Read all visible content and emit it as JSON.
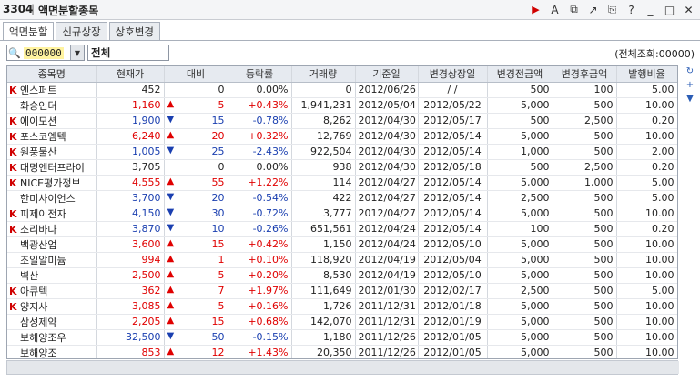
{
  "window": {
    "code": "3304",
    "separator": "|",
    "title": "액면분할종목"
  },
  "tabs": [
    {
      "label": "액면분할"
    },
    {
      "label": "신규상장"
    },
    {
      "label": "상호변경"
    }
  ],
  "filter": {
    "code": "000000",
    "name": "전체",
    "count_text": "(전체조회:00000)"
  },
  "table": {
    "headers": [
      "종목명",
      "현재가",
      "대비",
      "등락률",
      "거래량",
      "기준일",
      "변경상장일",
      "변경전금액",
      "변경후금액",
      "발행비율"
    ],
    "rows": [
      {
        "k": true,
        "name": "엔스퍼트",
        "price": "452",
        "dir": "",
        "diff": "0",
        "rate": "0.00%",
        "vol": "0",
        "base": "2012/06/26",
        "listdate": "/ /",
        "before": "500",
        "after": "100",
        "ratio": "5.00"
      },
      {
        "k": false,
        "name": "화승인더",
        "price": "1,160",
        "dir": "up",
        "diff": "5",
        "rate": "+0.43%",
        "vol": "1,941,231",
        "base": "2012/05/04",
        "listdate": "2012/05/22",
        "before": "5,000",
        "after": "500",
        "ratio": "10.00"
      },
      {
        "k": true,
        "name": "에이모션",
        "price": "1,900",
        "dir": "dn",
        "diff": "15",
        "rate": "-0.78%",
        "vol": "8,262",
        "base": "2012/04/30",
        "listdate": "2012/05/17",
        "before": "500",
        "after": "2,500",
        "ratio": "0.20"
      },
      {
        "k": true,
        "name": "포스코엠텍",
        "price": "6,240",
        "dir": "up",
        "diff": "20",
        "rate": "+0.32%",
        "vol": "12,769",
        "base": "2012/04/30",
        "listdate": "2012/05/14",
        "before": "5,000",
        "after": "500",
        "ratio": "10.00"
      },
      {
        "k": true,
        "name": "원풍물산",
        "price": "1,005",
        "dir": "dn",
        "diff": "25",
        "rate": "-2.43%",
        "vol": "922,504",
        "base": "2012/04/30",
        "listdate": "2012/05/14",
        "before": "1,000",
        "after": "500",
        "ratio": "2.00"
      },
      {
        "k": true,
        "name": "대명엔터프라이",
        "price": "3,705",
        "dir": "",
        "diff": "0",
        "rate": "0.00%",
        "vol": "938",
        "base": "2012/04/30",
        "listdate": "2012/05/18",
        "before": "500",
        "after": "2,500",
        "ratio": "0.20"
      },
      {
        "k": true,
        "name": "NICE평가정보",
        "price": "4,555",
        "dir": "up",
        "diff": "55",
        "rate": "+1.22%",
        "vol": "114",
        "base": "2012/04/27",
        "listdate": "2012/05/14",
        "before": "5,000",
        "after": "1,000",
        "ratio": "5.00"
      },
      {
        "k": false,
        "name": "한미사이언스",
        "price": "3,700",
        "dir": "dn",
        "diff": "20",
        "rate": "-0.54%",
        "vol": "422",
        "base": "2012/04/27",
        "listdate": "2012/05/14",
        "before": "2,500",
        "after": "500",
        "ratio": "5.00"
      },
      {
        "k": true,
        "name": "피제이전자",
        "price": "4,150",
        "dir": "dn",
        "diff": "30",
        "rate": "-0.72%",
        "vol": "3,777",
        "base": "2012/04/27",
        "listdate": "2012/05/14",
        "before": "5,000",
        "after": "500",
        "ratio": "10.00"
      },
      {
        "k": true,
        "name": "소리바다",
        "price": "3,870",
        "dir": "dn",
        "diff": "10",
        "rate": "-0.26%",
        "vol": "651,561",
        "base": "2012/04/24",
        "listdate": "2012/05/14",
        "before": "100",
        "after": "500",
        "ratio": "0.20"
      },
      {
        "k": false,
        "name": "백광산업",
        "price": "3,600",
        "dir": "up",
        "diff": "15",
        "rate": "+0.42%",
        "vol": "1,150",
        "base": "2012/04/24",
        "listdate": "2012/05/10",
        "before": "5,000",
        "after": "500",
        "ratio": "10.00"
      },
      {
        "k": false,
        "name": "조일알미늄",
        "price": "994",
        "dir": "up",
        "diff": "1",
        "rate": "+0.10%",
        "vol": "118,920",
        "base": "2012/04/19",
        "listdate": "2012/05/04",
        "before": "5,000",
        "after": "500",
        "ratio": "10.00"
      },
      {
        "k": false,
        "name": "벽산",
        "price": "2,500",
        "dir": "up",
        "diff": "5",
        "rate": "+0.20%",
        "vol": "8,530",
        "base": "2012/04/19",
        "listdate": "2012/05/10",
        "before": "5,000",
        "after": "500",
        "ratio": "10.00"
      },
      {
        "k": true,
        "name": "아큐텍",
        "price": "362",
        "dir": "up",
        "diff": "7",
        "rate": "+1.97%",
        "vol": "111,649",
        "base": "2012/01/30",
        "listdate": "2012/02/17",
        "before": "2,500",
        "after": "500",
        "ratio": "5.00"
      },
      {
        "k": true,
        "name": "양지사",
        "price": "3,085",
        "dir": "up",
        "diff": "5",
        "rate": "+0.16%",
        "vol": "1,726",
        "base": "2011/12/31",
        "listdate": "2012/01/18",
        "before": "5,000",
        "after": "500",
        "ratio": "10.00"
      },
      {
        "k": false,
        "name": "삼성제약",
        "price": "2,205",
        "dir": "up",
        "diff": "15",
        "rate": "+0.68%",
        "vol": "142,070",
        "base": "2011/12/31",
        "listdate": "2012/01/19",
        "before": "5,000",
        "after": "500",
        "ratio": "10.00"
      },
      {
        "k": false,
        "name": "보해양조우",
        "price": "32,500",
        "dir": "dn",
        "diff": "50",
        "rate": "-0.15%",
        "vol": "1,180",
        "base": "2011/12/26",
        "listdate": "2012/01/05",
        "before": "5,000",
        "after": "500",
        "ratio": "10.00"
      },
      {
        "k": false,
        "name": "보해양조",
        "price": "853",
        "dir": "up",
        "diff": "12",
        "rate": "+1.43%",
        "vol": "20,350",
        "base": "2011/12/26",
        "listdate": "2012/01/05",
        "before": "5,000",
        "after": "500",
        "ratio": "10.00"
      }
    ]
  },
  "colors": {
    "up": "#e00000",
    "down": "#1a3fb0",
    "k_marker": "#d00000",
    "code_highlight": "#fff3a0"
  },
  "icons": {
    "titlebar": [
      "play-icon",
      "font-icon",
      "new-window-icon",
      "link-icon",
      "copy-icon",
      "help-icon",
      "minimize-icon",
      "maximize-icon",
      "close-icon"
    ],
    "side": [
      "refresh-icon",
      "add-icon",
      "scroll-down-icon"
    ]
  }
}
